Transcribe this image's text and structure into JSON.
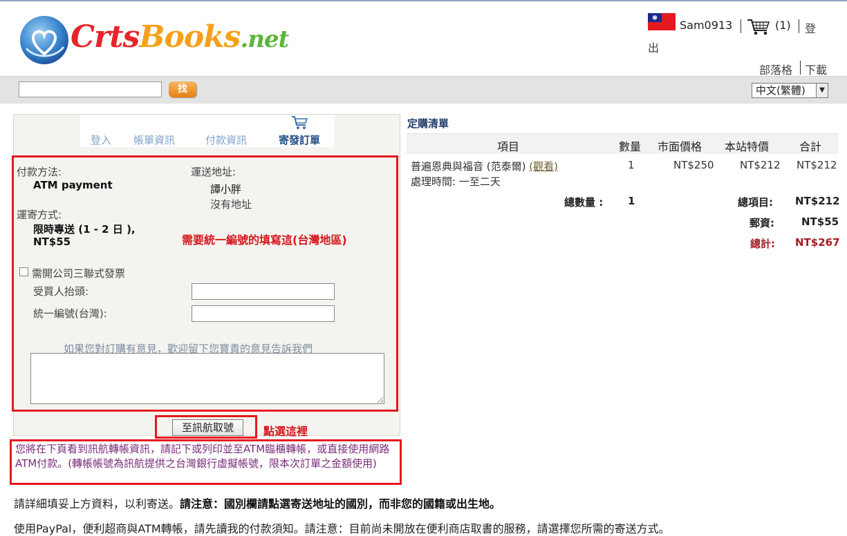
{
  "header": {
    "logo_text_a": "Crts",
    "logo_text_b": "Books",
    "logo_text_c": ".net",
    "username": "Sam0913",
    "cart_count": "(1)",
    "logout_part1": "登",
    "logout_part2": "出",
    "blog_link": "部落格",
    "download_link": "下載"
  },
  "search": {
    "button_label": "找",
    "value": "",
    "language_selected": "中文(繁體)"
  },
  "steps": {
    "login": "登入",
    "account": "帳單資訊",
    "payment": "付款資訊",
    "send_order": "寄發訂單"
  },
  "form": {
    "payment_method_label": "付款方法:",
    "payment_method_value": "ATM payment",
    "shipping_address_label": "運送地址:",
    "recipient_name": "譚小胖",
    "address_value": "沒有地址",
    "shipping_method_label": "運寄方式:",
    "shipping_method_line1": "限時專送 (1 - 2 日 ),",
    "shipping_method_line2": "NT$55",
    "tax_id_note": "需要統一編號的填寫這(台灣地區)",
    "invoice_checkbox_label": "需開公司三聯式發票",
    "buyer_title_label": "受買人抬頭:",
    "tax_id_label": "統一編號(台灣):",
    "buyer_title_value": "",
    "tax_id_value": "",
    "comment_prompt": "如果您對訂購有意見，歡迎留下您寶貴的意見告訴我們",
    "comment_value": "",
    "submit_label": "至訊航取號",
    "click_here_note": "點選這裡",
    "notice": "您將在下頁看到訊航轉帳資訊，請記下或列印並至ATM臨櫃轉帳，或直接使用網路ATM付款。(轉帳帳號為訊航提供之台灣銀行虛擬帳號，限本次訂單之金額使用)"
  },
  "order": {
    "title": "定購清單",
    "columns": [
      "項目",
      "數量",
      "市面價格",
      "本站特價",
      "合計"
    ],
    "item": {
      "name": "普遍恩典與福音 (范泰爾)",
      "view_link": "(觀看)",
      "processing": "處理時間: 一至二天",
      "qty": "1",
      "market_price": "NT$250",
      "special_price": "NT$212",
      "subtotal": "NT$212"
    },
    "total_qty_label": "總數量 :",
    "total_qty": "1",
    "total_items_label": "總項目:",
    "total_items": "NT$212",
    "shipping_label": "郵資:",
    "shipping": "NT$55",
    "grand_total_label": "總計:",
    "grand_total": "NT$267"
  },
  "bottom": {
    "note_plain": "請詳細填妥上方資料，以利寄送。",
    "note_bold": "請注意：國別欄請點選寄送地址的國別，而非您的國籍或出生地。",
    "paypal_note": "使用PayPal，便利超商與ATM轉帳，請先讀我的付款須知。請注意：目前尚未開放在便利商店取書的服務，請選擇您所需的寄送方式。"
  },
  "colors": {
    "accent_red": "#e3191f",
    "search_button": "#e57f12",
    "step_active": "#1f4d86",
    "step_inactive": "#7fa4c9",
    "grand_total": "#a41d25",
    "notice_text": "#7a2b7a"
  },
  "icons": [
    "taiwan-flag-icon",
    "shopping-cart-icon",
    "dropdown-arrow-icon",
    "checkbox-icon",
    "globe-heart-logo-icon"
  ]
}
